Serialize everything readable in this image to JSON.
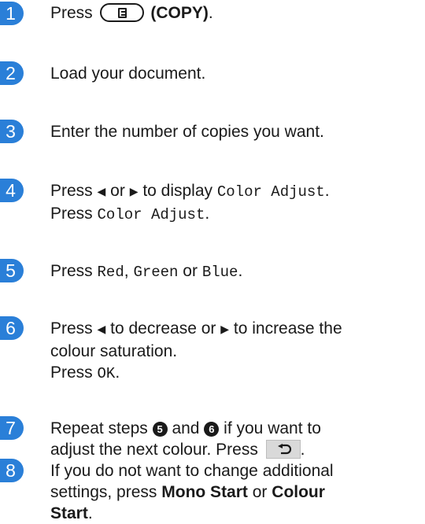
{
  "accent_color": "#2a7fd8",
  "steps": [
    {
      "num": "1",
      "press": "Press",
      "copy_key_icon": "copy-key-icon",
      "copy_label": "(COPY)",
      "end": "."
    },
    {
      "num": "2",
      "text": "Load your document."
    },
    {
      "num": "3",
      "text": "Enter the number of copies you want."
    },
    {
      "num": "4",
      "press": "Press",
      "left_arrow": "◀",
      "or": "or",
      "right_arrow": "▶",
      "to_display": "to display",
      "menu_item": "Color Adjust",
      "end": ".",
      "press2": "Press",
      "menu_item2": "Color Adjust",
      "end2": "."
    },
    {
      "num": "5",
      "press": "Press",
      "opt1": "Red",
      "comma": ",",
      "opt2": "Green",
      "or": "or",
      "opt3": "Blue",
      "end": "."
    },
    {
      "num": "6",
      "press": "Press",
      "left_arrow": "◀",
      "to_decrease": "to decrease or",
      "right_arrow": "▶",
      "to_increase": "to increase the",
      "line2": "colour saturation.",
      "press2": "Press",
      "ok": "OK",
      "end": "."
    },
    {
      "num": "7",
      "repeat": "Repeat steps",
      "ref1": "5",
      "and": "and",
      "ref2": "6",
      "if_want": "if you want to",
      "line2": "adjust the next colour. Press",
      "end": "."
    },
    {
      "num": "8",
      "line1": "If you do not want to change additional",
      "line2a": "settings, press",
      "mono_start": "Mono Start",
      "or": "or",
      "colour": "Colour",
      "start": "Start",
      "end": "."
    }
  ]
}
